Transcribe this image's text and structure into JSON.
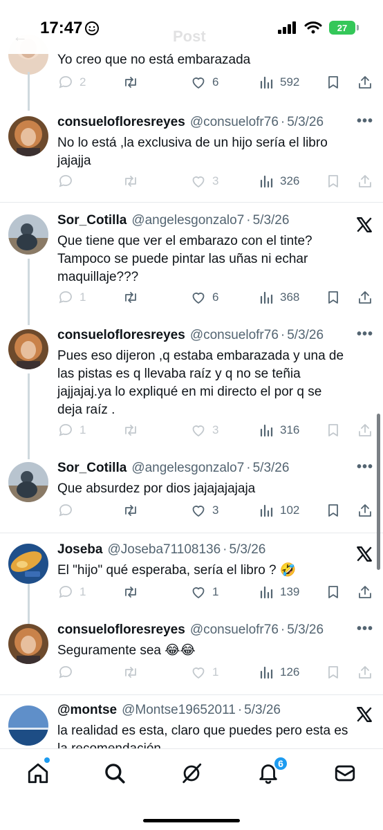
{
  "status_bar": {
    "time": "17:47",
    "battery": "27"
  },
  "faded_header": {
    "back": "←",
    "title": "Post"
  },
  "top_partial": {
    "text": "Yo creo que no está embarazada",
    "replies": "2",
    "likes": "6",
    "views": "592"
  },
  "tweets": [
    {
      "name": "consuelofloresreyes",
      "handle": "@consuelofr76",
      "date": "5/3/26",
      "text": "No lo está ,la exclusiva de un hijo sería el libro\njajajja",
      "replies": "",
      "likes": "3",
      "views": "326",
      "head_icon": "more-icon"
    },
    {
      "name": "Sor_Cotilla",
      "handle": "@angelesgonzalo7",
      "date": "5/3/26",
      "text": "Que tiene que ver el embarazo con el tinte?\nTampoco se puede pintar las uñas ni echar\nmaquillaje???",
      "replies": "1",
      "likes": "6",
      "views": "368",
      "head_icon": "x-logo-icon"
    },
    {
      "name": "consuelofloresreyes",
      "handle": "@consuelofr76",
      "date": "5/3/26",
      "text": "Pues eso dijeron ,q estaba embarazada y una de\nlas pistas es q llevaba raíz y q no se teñia\njajjajaj.ya lo expliqué en mi directo el por q se\ndeja raíz .",
      "replies": "1",
      "likes": "3",
      "views": "316",
      "head_icon": "more-icon"
    },
    {
      "name": "Sor_Cotilla",
      "handle": "@angelesgonzalo7",
      "date": "5/3/26",
      "text": "Que absurdez por dios jajajajajaja",
      "replies": "",
      "likes": "3",
      "views": "102",
      "head_icon": "more-icon"
    },
    {
      "name": "Joseba",
      "handle": "@Joseba71108136",
      "date": "5/3/26",
      "text": "El \"hijo\" qué esperaba, sería el libro ? 🤣",
      "replies": "1",
      "likes": "1",
      "views": "139",
      "head_icon": "x-logo-icon"
    },
    {
      "name": "consuelofloresreyes",
      "handle": "@consuelofr76",
      "date": "5/3/26",
      "text": "Seguramente sea 😂😂",
      "replies": "",
      "likes": "1",
      "views": "126",
      "head_icon": "more-icon"
    },
    {
      "name": "@montse",
      "handle": "@Montse19652011",
      "date": "5/3/26",
      "text": "la realidad es esta, claro que puedes pero esta es\nla recomendación",
      "replies": "",
      "likes": "",
      "views": "",
      "head_icon": "x-logo-icon"
    }
  ],
  "more_glyph": "•••",
  "date_separator": "·",
  "nav": {
    "notifications_badge": "6"
  },
  "colors": {
    "accent": "#1d9bf0",
    "text": "#0f1419",
    "secondary": "#536471",
    "battery": "#34c759"
  }
}
